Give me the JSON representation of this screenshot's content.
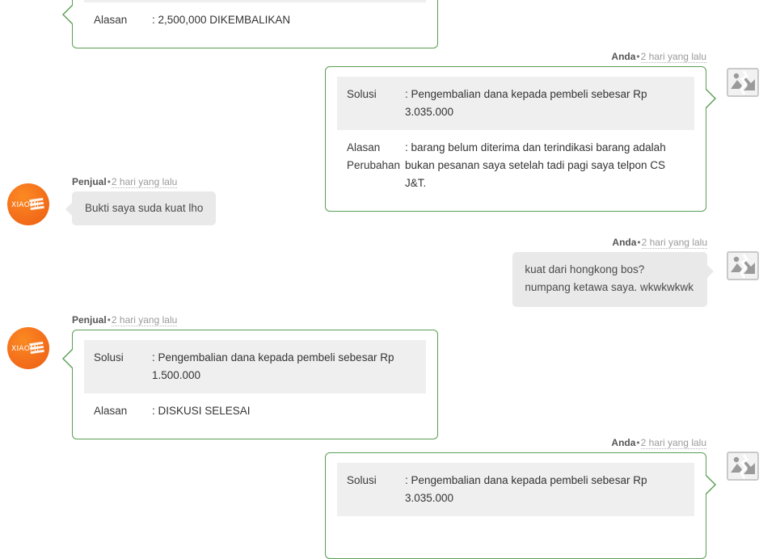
{
  "thread": {
    "messages": [
      {
        "id": "msg-top-partial",
        "side": "left",
        "author": "",
        "time": "",
        "kind": "solution-card",
        "rows": [
          {
            "key": "Alasan",
            "value": ": 2,500,000 DIKEMBALIKAN",
            "shaded": false
          }
        ]
      },
      {
        "id": "msg-anda-1",
        "side": "right",
        "author": "Anda",
        "separator": "•",
        "time": "2 hari yang lalu",
        "kind": "solution-card",
        "rows": [
          {
            "key": "Solusi",
            "value": ": Pengembalian dana kepada pembeli sebesar Rp 3.035.000",
            "shaded": true
          },
          {
            "key": "Alasan Perubahan",
            "value": ": barang belum diterima dan terindikasi barang adalah bukan pesanan saya setelah tadi pagi saya telpon CS J&T.",
            "shaded": false
          }
        ],
        "attachment": "broken-image-icon"
      },
      {
        "id": "msg-penjual-1",
        "side": "left",
        "author": "Penjual",
        "separator": "•",
        "time": "2 hari yang lalu",
        "kind": "text",
        "avatar": {
          "brand": "XIAOMI",
          "color": "#f4701b"
        },
        "lines": [
          "Bukti saya suda kuat lho"
        ]
      },
      {
        "id": "msg-anda-2",
        "side": "right",
        "author": "Anda",
        "separator": "•",
        "time": "2 hari yang lalu",
        "kind": "text",
        "lines": [
          "kuat dari hongkong bos?",
          "numpang ketawa saya. wkwkwkwk"
        ],
        "attachment": "broken-image-icon"
      },
      {
        "id": "msg-penjual-2",
        "side": "left",
        "author": "Penjual",
        "separator": "•",
        "time": "2 hari yang lalu",
        "kind": "solution-card",
        "avatar": {
          "brand": "XIAOMI",
          "color": "#f4701b"
        },
        "rows": [
          {
            "key": "Solusi",
            "value": ": Pengembalian dana kepada pembeli sebesar Rp 1.500.000",
            "shaded": true
          },
          {
            "key": "Alasan",
            "value": ": DISKUSI SELESAI",
            "shaded": false
          }
        ]
      },
      {
        "id": "msg-anda-3",
        "side": "right",
        "author": "Anda",
        "separator": "•",
        "time": "2 hari yang lalu",
        "kind": "solution-card",
        "rows": [
          {
            "key": "Solusi",
            "value": ": Pengembalian dana kepada pembeli sebesar Rp 3.035.000",
            "shaded": true
          }
        ],
        "attachment": "broken-image-icon"
      }
    ]
  },
  "colors": {
    "accent_green": "#5a9e52",
    "bubble_gray": "#e9e9e9",
    "row_shade": "#efefef",
    "avatar_orange": "#f4701b",
    "meta_gray": "#9a9a9a",
    "page_bg": "#ffffff"
  }
}
